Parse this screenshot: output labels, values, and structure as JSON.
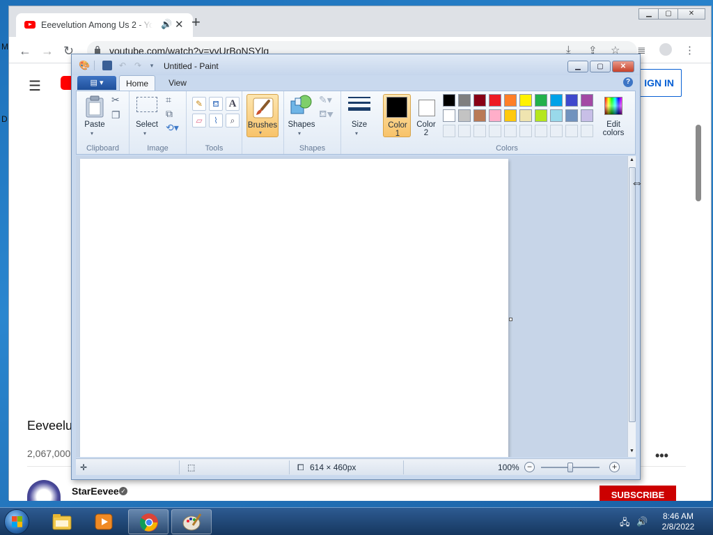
{
  "browser": {
    "tab_title": "Eeevelution Among Us 2 - Yo",
    "new_tab": "+",
    "tab_close": "✕",
    "url": "youtube.com/watch?v=yvUrBoNSYlg",
    "win_min": "▁",
    "win_max": "▢",
    "win_close": "✕"
  },
  "youtube": {
    "sign_in": "IGN IN",
    "video_title": "Eeveelut",
    "views": "2,067,000",
    "more": "•••",
    "channel": "StarEevee",
    "subscribe": "SUBSCRIBE",
    "edge_m": "M",
    "edge_d": "D"
  },
  "paint": {
    "title": "Untitled - Paint",
    "tabs": {
      "home": "Home",
      "view": "View"
    },
    "help": "?",
    "groups": {
      "clipboard": "Clipboard",
      "image": "Image",
      "tools": "Tools",
      "shapes": "Shapes",
      "colors": "Colors"
    },
    "buttons": {
      "paste": "Paste",
      "select": "Select",
      "brushes": "Brushes",
      "shapes": "Shapes",
      "size": "Size",
      "color1_line1": "Color",
      "color1_line2": "1",
      "color2_line1": "Color",
      "color2_line2": "2",
      "edit_colors_line1": "Edit",
      "edit_colors_line2": "colors"
    },
    "palette_row1": [
      "#000000",
      "#7f7f7f",
      "#880015",
      "#ed1c24",
      "#ff7f27",
      "#fff200",
      "#22b14c",
      "#00a2e8",
      "#3f48cc",
      "#a349a4"
    ],
    "palette_row2": [
      "#ffffff",
      "#c3c3c3",
      "#b97a57",
      "#ffaec9",
      "#ffc90e",
      "#efe4b0",
      "#b5e61d",
      "#99d9ea",
      "#7092be",
      "#c8bfe7"
    ],
    "color1": "#000000",
    "color2": "#ffffff",
    "status": {
      "image_size": "614 × 460px",
      "zoom": "100%"
    }
  },
  "taskbar": {
    "time": "8:46 AM",
    "date": "2/8/2022"
  }
}
